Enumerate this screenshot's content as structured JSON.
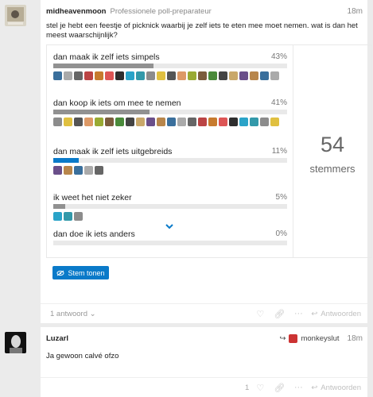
{
  "post1": {
    "username": "midheavenmoon",
    "user_title": "Professionele poll-preparateur",
    "time": "18m",
    "text": "stel je hebt een feestje of picknick waarbij je zelf iets te eten mee moet nemen. wat is dan het meest waarschijnlijk?",
    "poll": {
      "options": [
        {
          "label": "dan maak ik zelf iets simpels",
          "percent": "43%",
          "fraction": 0.43
        },
        {
          "label": "dan koop ik iets om mee te nemen",
          "percent": "41%",
          "fraction": 0.41
        },
        {
          "label": "dan maak ik zelf iets uitgebreids",
          "percent": "11%",
          "fraction": 0.11
        },
        {
          "label": "ik weet het niet zeker",
          "percent": "5%",
          "fraction": 0.05
        },
        {
          "label": "dan doe ik iets anders",
          "percent": "0%",
          "fraction": 0.0
        }
      ],
      "voters_count": "54",
      "voters_label": "stemmers",
      "show_votes_button": "Stem tonen"
    },
    "replies_label": "1 antwoord",
    "reply_button": "Antwoorden"
  },
  "post2": {
    "username": "Luzarl",
    "time": "18m",
    "reply_to_user": "monkeyslut",
    "text": "Ja gewoon calvé ofzo",
    "like_count": "1",
    "reply_button": "Antwoorden"
  },
  "colors": {
    "accent": "#0a7ac9",
    "bar_bg": "#e9e9e9",
    "bar_fill": "#919191"
  }
}
